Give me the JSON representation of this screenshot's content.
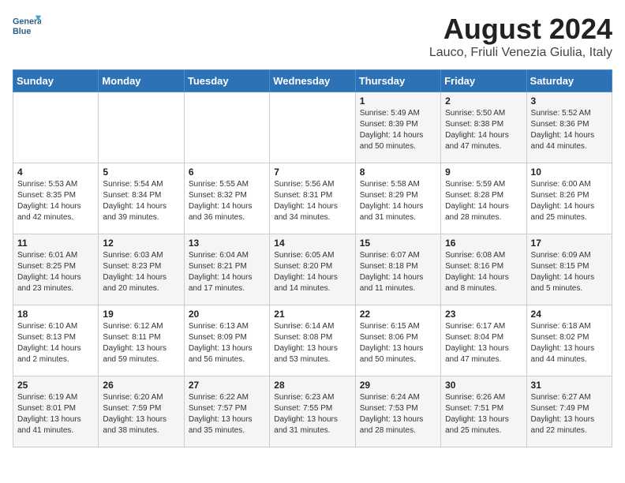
{
  "logo": {
    "line1": "General",
    "line2": "Blue"
  },
  "title": "August 2024",
  "subtitle": "Lauco, Friuli Venezia Giulia, Italy",
  "days_of_week": [
    "Sunday",
    "Monday",
    "Tuesday",
    "Wednesday",
    "Thursday",
    "Friday",
    "Saturday"
  ],
  "weeks": [
    [
      {
        "day": "",
        "info": ""
      },
      {
        "day": "",
        "info": ""
      },
      {
        "day": "",
        "info": ""
      },
      {
        "day": "",
        "info": ""
      },
      {
        "day": "1",
        "info": "Sunrise: 5:49 AM\nSunset: 8:39 PM\nDaylight: 14 hours\nand 50 minutes."
      },
      {
        "day": "2",
        "info": "Sunrise: 5:50 AM\nSunset: 8:38 PM\nDaylight: 14 hours\nand 47 minutes."
      },
      {
        "day": "3",
        "info": "Sunrise: 5:52 AM\nSunset: 8:36 PM\nDaylight: 14 hours\nand 44 minutes."
      }
    ],
    [
      {
        "day": "4",
        "info": "Sunrise: 5:53 AM\nSunset: 8:35 PM\nDaylight: 14 hours\nand 42 minutes."
      },
      {
        "day": "5",
        "info": "Sunrise: 5:54 AM\nSunset: 8:34 PM\nDaylight: 14 hours\nand 39 minutes."
      },
      {
        "day": "6",
        "info": "Sunrise: 5:55 AM\nSunset: 8:32 PM\nDaylight: 14 hours\nand 36 minutes."
      },
      {
        "day": "7",
        "info": "Sunrise: 5:56 AM\nSunset: 8:31 PM\nDaylight: 14 hours\nand 34 minutes."
      },
      {
        "day": "8",
        "info": "Sunrise: 5:58 AM\nSunset: 8:29 PM\nDaylight: 14 hours\nand 31 minutes."
      },
      {
        "day": "9",
        "info": "Sunrise: 5:59 AM\nSunset: 8:28 PM\nDaylight: 14 hours\nand 28 minutes."
      },
      {
        "day": "10",
        "info": "Sunrise: 6:00 AM\nSunset: 8:26 PM\nDaylight: 14 hours\nand 25 minutes."
      }
    ],
    [
      {
        "day": "11",
        "info": "Sunrise: 6:01 AM\nSunset: 8:25 PM\nDaylight: 14 hours\nand 23 minutes."
      },
      {
        "day": "12",
        "info": "Sunrise: 6:03 AM\nSunset: 8:23 PM\nDaylight: 14 hours\nand 20 minutes."
      },
      {
        "day": "13",
        "info": "Sunrise: 6:04 AM\nSunset: 8:21 PM\nDaylight: 14 hours\nand 17 minutes."
      },
      {
        "day": "14",
        "info": "Sunrise: 6:05 AM\nSunset: 8:20 PM\nDaylight: 14 hours\nand 14 minutes."
      },
      {
        "day": "15",
        "info": "Sunrise: 6:07 AM\nSunset: 8:18 PM\nDaylight: 14 hours\nand 11 minutes."
      },
      {
        "day": "16",
        "info": "Sunrise: 6:08 AM\nSunset: 8:16 PM\nDaylight: 14 hours\nand 8 minutes."
      },
      {
        "day": "17",
        "info": "Sunrise: 6:09 AM\nSunset: 8:15 PM\nDaylight: 14 hours\nand 5 minutes."
      }
    ],
    [
      {
        "day": "18",
        "info": "Sunrise: 6:10 AM\nSunset: 8:13 PM\nDaylight: 14 hours\nand 2 minutes."
      },
      {
        "day": "19",
        "info": "Sunrise: 6:12 AM\nSunset: 8:11 PM\nDaylight: 13 hours\nand 59 minutes."
      },
      {
        "day": "20",
        "info": "Sunrise: 6:13 AM\nSunset: 8:09 PM\nDaylight: 13 hours\nand 56 minutes."
      },
      {
        "day": "21",
        "info": "Sunrise: 6:14 AM\nSunset: 8:08 PM\nDaylight: 13 hours\nand 53 minutes."
      },
      {
        "day": "22",
        "info": "Sunrise: 6:15 AM\nSunset: 8:06 PM\nDaylight: 13 hours\nand 50 minutes."
      },
      {
        "day": "23",
        "info": "Sunrise: 6:17 AM\nSunset: 8:04 PM\nDaylight: 13 hours\nand 47 minutes."
      },
      {
        "day": "24",
        "info": "Sunrise: 6:18 AM\nSunset: 8:02 PM\nDaylight: 13 hours\nand 44 minutes."
      }
    ],
    [
      {
        "day": "25",
        "info": "Sunrise: 6:19 AM\nSunset: 8:01 PM\nDaylight: 13 hours\nand 41 minutes."
      },
      {
        "day": "26",
        "info": "Sunrise: 6:20 AM\nSunset: 7:59 PM\nDaylight: 13 hours\nand 38 minutes."
      },
      {
        "day": "27",
        "info": "Sunrise: 6:22 AM\nSunset: 7:57 PM\nDaylight: 13 hours\nand 35 minutes."
      },
      {
        "day": "28",
        "info": "Sunrise: 6:23 AM\nSunset: 7:55 PM\nDaylight: 13 hours\nand 31 minutes."
      },
      {
        "day": "29",
        "info": "Sunrise: 6:24 AM\nSunset: 7:53 PM\nDaylight: 13 hours\nand 28 minutes."
      },
      {
        "day": "30",
        "info": "Sunrise: 6:26 AM\nSunset: 7:51 PM\nDaylight: 13 hours\nand 25 minutes."
      },
      {
        "day": "31",
        "info": "Sunrise: 6:27 AM\nSunset: 7:49 PM\nDaylight: 13 hours\nand 22 minutes."
      }
    ]
  ]
}
